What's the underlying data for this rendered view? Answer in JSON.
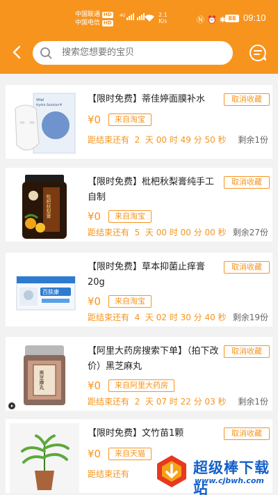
{
  "status_bar": {
    "carrier1": "中国联通",
    "carrier2": "中国电信",
    "hd_badge": "HD",
    "net_type": "4G",
    "speed_value": "2.1",
    "speed_unit": "K/s",
    "battery": "88",
    "time": "09:10"
  },
  "nav": {
    "search_placeholder": "搜索您想要的宝贝"
  },
  "items": [
    {
      "title": "【限时免费】蒂佳婷面膜补水",
      "fav_label": "取消收藏",
      "price": "¥0",
      "source": "来自淘宝",
      "countdown": "距结束还有  2  天 00 时 49 分 50 秒",
      "remain": "剩余1份",
      "image": "face-mask-product",
      "pack_label1": "Vital",
      "pack_label2": "Hydra Solution®"
    },
    {
      "title": "【限时免费】枇杷秋梨膏纯手工自制",
      "fav_label": "取消收藏",
      "price": "¥0",
      "source": "来自淘宝",
      "countdown": "距结束还有  5  天 00 时 00 分 00 秒",
      "remain": "剩余27份",
      "image": "loquat-paste-jar",
      "jar_label": "枇杷秋梨膏"
    },
    {
      "title": "【限时免费】草本抑菌止痒膏20g",
      "fav_label": "取消收藏",
      "price": "¥0",
      "source": "来自淘宝",
      "countdown": "距结束还有  4  天 02 时 30 分 40 秒",
      "remain": "剩余19份",
      "image": "ointment-box",
      "box_label": "百肤康"
    },
    {
      "title": "【阿里大药房搜索下单】（拍下改价）黑芝麻丸",
      "fav_label": "取消收藏",
      "price": "¥0",
      "source": "来自阿里大药房",
      "countdown": "距结束还有  2  天 07 时 22 分 03 秒",
      "remain": "剩余1份",
      "image": "sesame-pill-jar",
      "jar_label": "黑芝麻丸"
    },
    {
      "title": "【限时免费】文竹苗1颗",
      "fav_label": "取消收藏",
      "price": "¥0",
      "source": "来自天猫",
      "countdown": "距结束还有",
      "remain": "",
      "image": "asparagus-fern-plant"
    }
  ],
  "watermark": {
    "name": "超级棒下载站",
    "url": "www.cjbwh.com"
  },
  "colors": {
    "accent": "#f7941d",
    "background": "#f2f2f2",
    "watermark": "#1560c9"
  }
}
